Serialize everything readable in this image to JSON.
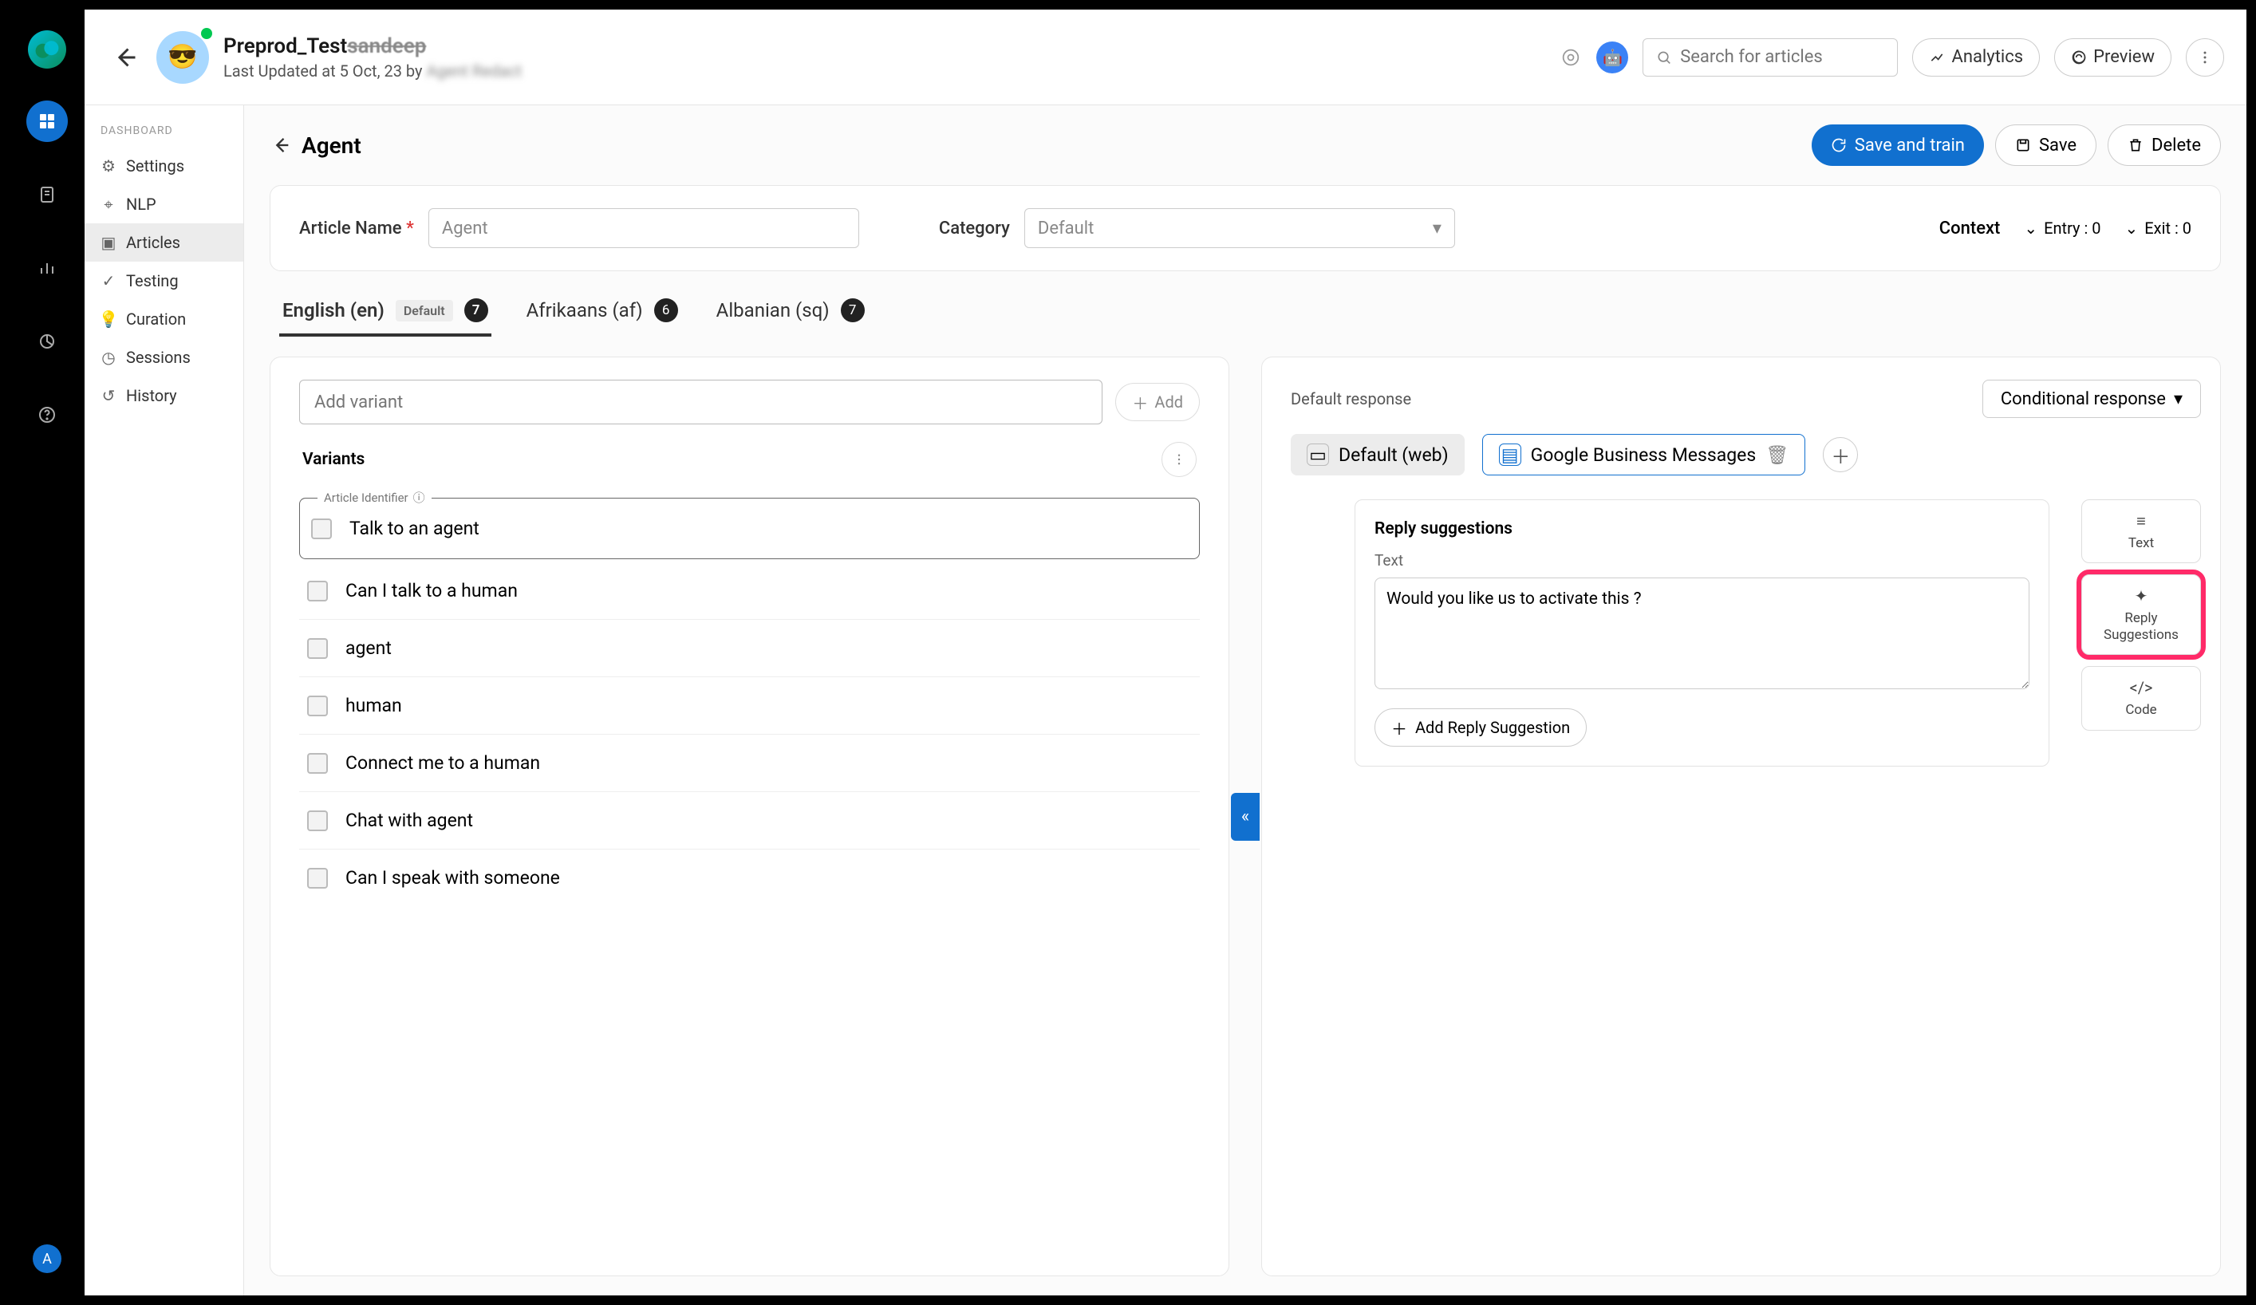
{
  "rail": {
    "avatar_initial": "A"
  },
  "topbar": {
    "project_name_prefix": "Preprod_Test",
    "project_name_strike": "sandeep",
    "subtitle_prefix": "Last Updated at 5 Oct, 23 by ",
    "subtitle_blur": "Agent Redact",
    "search_placeholder": "Search for articles",
    "analytics": "Analytics",
    "preview": "Preview"
  },
  "sidebar": {
    "section": "DASHBOARD",
    "items": [
      {
        "label": "Settings"
      },
      {
        "label": "NLP"
      },
      {
        "label": "Articles"
      },
      {
        "label": "Testing"
      },
      {
        "label": "Curation"
      },
      {
        "label": "Sessions"
      },
      {
        "label": "History"
      }
    ]
  },
  "page": {
    "title": "Agent",
    "save_train": "Save and train",
    "save": "Save",
    "delete": "Delete"
  },
  "meta": {
    "article_name_label": "Article Name",
    "article_name_value": "Agent",
    "category_label": "Category",
    "category_value": "Default",
    "context_label": "Context",
    "entry_label": "Entry : 0",
    "exit_label": "Exit : 0"
  },
  "tabs": [
    {
      "label": "English (en)",
      "badge": "Default",
      "count": "7"
    },
    {
      "label": "Afrikaans (af)",
      "count": "6"
    },
    {
      "label": "Albanian (sq)",
      "count": "7"
    }
  ],
  "variants": {
    "input_placeholder": "Add variant",
    "add_btn": "Add",
    "title": "Variants",
    "identifier_label": "Article Identifier",
    "items": [
      "Talk to an agent",
      "Can I talk to a human",
      "agent",
      "human",
      "Connect me to a human",
      "Chat with agent",
      "Can I speak with someone"
    ]
  },
  "response": {
    "default_label": "Default response",
    "conditional_btn": "Conditional response",
    "channels": {
      "default": "Default (web)",
      "gbm": "Google Business Messages"
    },
    "card_title": "Reply suggestions",
    "text_label": "Text",
    "text_value": "Would you like us to activate this ?",
    "add_reply_btn": "Add Reply Suggestion",
    "tools": {
      "text": "Text",
      "reply": "Reply Suggestions",
      "code": "Code"
    }
  }
}
